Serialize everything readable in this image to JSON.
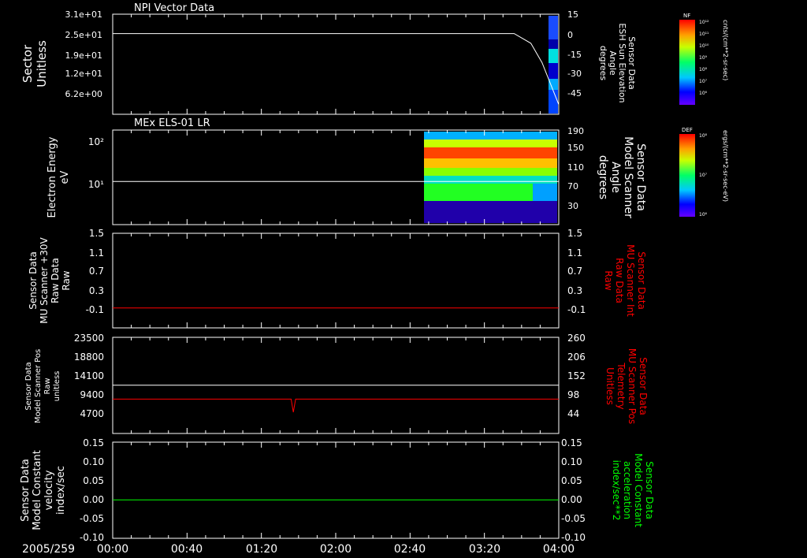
{
  "date_label": "2005/259",
  "time_ticks": [
    "00:00",
    "00:40",
    "01:20",
    "02:00",
    "02:40",
    "03:20",
    "04:00"
  ],
  "colors": {
    "background": "#000000",
    "white": "#ffffff",
    "red": "#ff0000",
    "green": "#00ff00"
  },
  "chart_data": [
    {
      "type": "line",
      "title": "NPI Vector Data",
      "ylabel_lines": [
        "Sector",
        "Unitless"
      ],
      "y_ticks": [
        "3.1e+01",
        "2.5e+01",
        "1.9e+01",
        "1.2e+01",
        "6.2e+00"
      ],
      "right_ticks": [
        "15",
        "0",
        "-15",
        "-30",
        "-45"
      ],
      "right_label_lines": [
        "Sensor Data",
        "ESH Sun Elevation",
        "Angle",
        "degrees"
      ],
      "colorbar": {
        "label": "NF",
        "ticks": [
          "10¹²",
          "10¹¹",
          "10¹⁰",
          "10⁹",
          "10⁸",
          "10⁷",
          "10⁶"
        ],
        "unit": "cnts/(cm**2-sr-sec)"
      },
      "series": [
        {
          "color": "#ffffff",
          "x": [
            0,
            0.5,
            1,
            1.5,
            2,
            2.5,
            3,
            3.4,
            3.6,
            3.75,
            3.85,
            4.0
          ],
          "y": [
            25,
            25,
            25,
            25,
            25,
            25,
            25,
            25,
            25,
            22,
            16,
            3
          ]
        }
      ]
    },
    {
      "type": "heatmap",
      "title": "MEx ELS-01 LR",
      "ylabel_lines": [
        "Electron Energy",
        "eV"
      ],
      "y_ticks": [
        "10²",
        "10¹"
      ],
      "right_ticks": [
        "190",
        "150",
        "110",
        "70",
        "30"
      ],
      "right_label_lines": [
        "Sensor Data",
        "Model Scanner",
        "Angle",
        "degrees"
      ],
      "colorbar": {
        "label": "DEF",
        "ticks": [
          "10⁸",
          "10⁷",
          "10⁶"
        ],
        "unit": "ergs/(cm**2-sr-sec-eV)"
      },
      "series": [
        {
          "color": "#ffffff",
          "x": [
            0,
            4.0
          ],
          "y": [
            14,
            14
          ]
        }
      ],
      "spectrogram_start_hour": 2.72
    },
    {
      "type": "line",
      "ylabel_lines": [
        "Sensor Data",
        "MU Scanner +30V",
        "Raw Data",
        "Raw"
      ],
      "y_ticks": [
        "1.5",
        "1.1",
        "0.7",
        "0.3",
        "-0.1"
      ],
      "right_ticks": [
        "1.5",
        "1.1",
        "0.7",
        "0.3",
        "-0.1"
      ],
      "right_label_lines": [
        "Sensor Data",
        "MU Scanner Int",
        "Raw Data",
        "Raw"
      ],
      "ylim": [
        -0.4,
        1.5
      ],
      "series": [
        {
          "color": "#ff0000",
          "x": [
            0,
            4.0
          ],
          "y": [
            0.0,
            0.0
          ]
        }
      ]
    },
    {
      "type": "line",
      "ylabel_lines": [
        "Sensor Data",
        "Model Scanner Pos",
        "Raw",
        "unitless"
      ],
      "y_ticks": [
        "23500",
        "18800",
        "14100",
        "9400",
        "4700"
      ],
      "right_ticks": [
        "260",
        "206",
        "152",
        "98",
        "44"
      ],
      "right_label_lines": [
        "Sensor Data",
        "MU Scanner Pos",
        "Telemetry",
        "Unitless"
      ],
      "ylim": [
        0,
        23500
      ],
      "series": [
        {
          "color": "#ffffff",
          "x": [
            0,
            4.0
          ],
          "y": [
            11800,
            11800
          ]
        },
        {
          "color": "#ff0000",
          "x": [
            0,
            1.6,
            1.62,
            1.64,
            1.66,
            4.0
          ],
          "y": [
            8400,
            8400,
            5200,
            8400,
            8400,
            8400
          ]
        }
      ]
    },
    {
      "type": "line",
      "ylabel_lines": [
        "Sensor Data",
        "Model Constant",
        "velocity",
        "index/sec"
      ],
      "y_ticks": [
        "0.15",
        "0.10",
        "0.05",
        "0.00",
        "-0.05",
        "-0.10"
      ],
      "right_ticks": [
        "0.15",
        "0.10",
        "0.05",
        "0.00",
        "-0.05",
        "-0.10"
      ],
      "right_label_lines": [
        "Sensor Data",
        "Model Constant",
        "acceleration",
        "index/sec**2"
      ],
      "ylim": [
        -0.1,
        0.15
      ],
      "series": [
        {
          "color": "#00ff00",
          "x": [
            0,
            4.0
          ],
          "y": [
            0.0,
            0.0
          ]
        }
      ]
    }
  ]
}
